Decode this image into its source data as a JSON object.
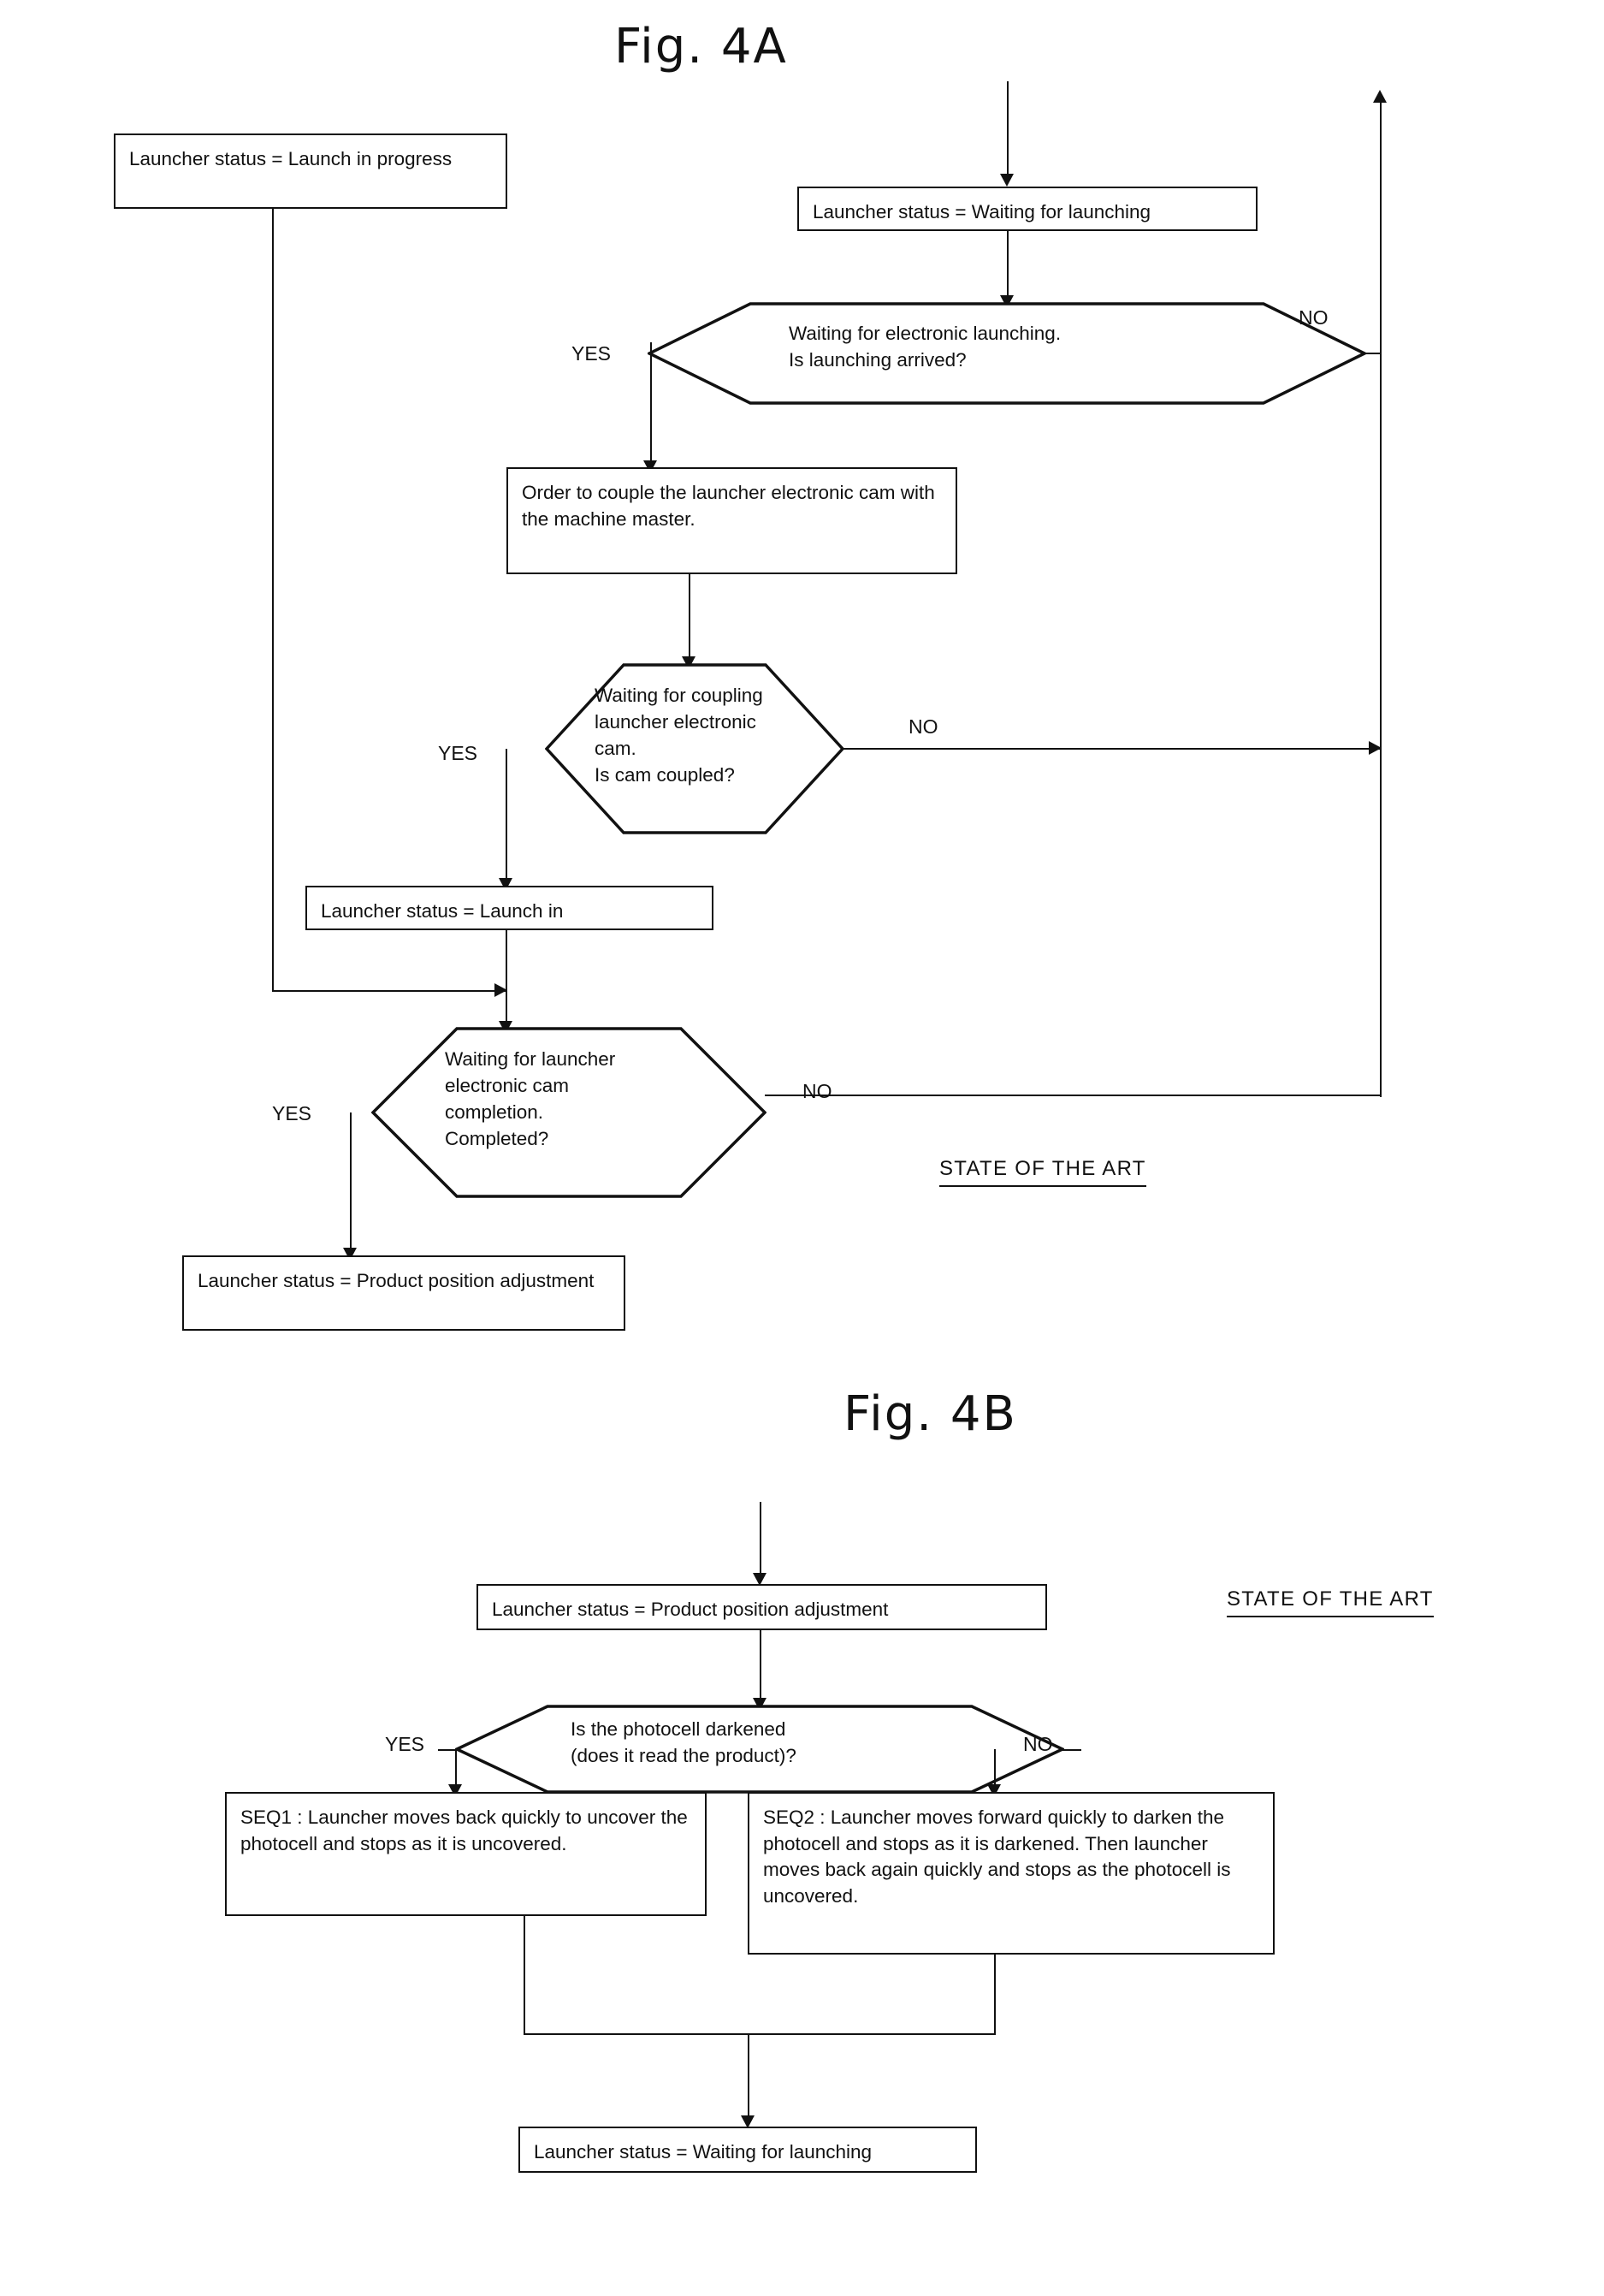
{
  "document": {
    "type": "patent-flowchart",
    "ink_color": "#111111",
    "background_color": "#ffffff"
  },
  "figures": [
    {
      "id": "fig-4a",
      "title": "Fig. 4A",
      "note": "STATE OF THE ART",
      "nodes": {
        "launch_in_progress": "Launcher status = Launch in progress",
        "waiting_for_launching": "Launcher status = Waiting for launching",
        "decision_launching": "Waiting for electronic launching.\nIs launching arrived?",
        "order_couple": "Order to couple the launcher electronic\ncam with the machine master.",
        "decision_coupling": "Waiting for coupling\nlauncher electronic\ncam.\nIs cam coupled?",
        "launch_in": "Launcher status = Launch in",
        "decision_completion": "Waiting for launcher\nelectronic cam\ncompletion.\nCompleted?",
        "product_position": "Launcher status = Product position adjustment"
      },
      "branch_labels": {
        "d1_yes": "YES",
        "d1_no": "NO",
        "d2_yes": "YES",
        "d2_no": "NO",
        "d3_yes": "YES",
        "d3_no": "NO"
      }
    },
    {
      "id": "fig-4b",
      "title": "Fig. 4B",
      "note": "STATE OF THE ART",
      "nodes": {
        "product_position": "Launcher status = Product position adjustment",
        "decision_photocell": "Is the photocell darkened\n(does it read the product)?",
        "seq1": "SEQ1 : Launcher moves back quickly to\nuncover the photocell and stops as it is\nuncovered.",
        "seq2": "SEQ2 : Launcher moves forward quickly to\ndarken the photocell and stops as it is\ndarkened. Then launcher moves back again\nquickly and stops as the photocell is uncovered.",
        "waiting_for_launching": "Launcher status = Waiting for launching"
      },
      "branch_labels": {
        "d1_yes": "YES",
        "d1_no": "NO"
      }
    }
  ]
}
